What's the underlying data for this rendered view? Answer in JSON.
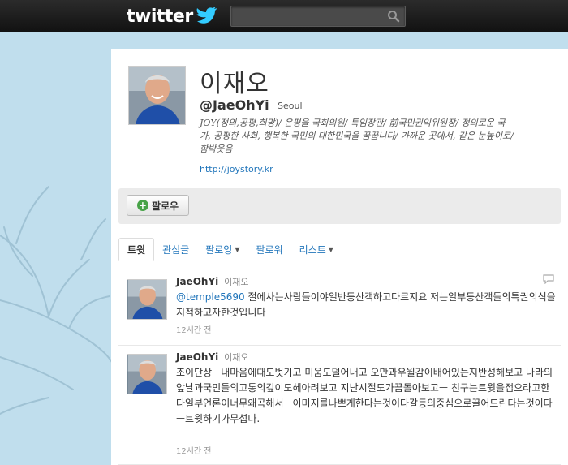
{
  "topbar": {
    "logo_text": "twitter",
    "search_placeholder": ""
  },
  "profile": {
    "name": "이재오",
    "handle": "@JaeOhYi",
    "location": "Seoul",
    "bio": "JOY(정의,공평,희망)/ 은평을 국회의원/ 특임장관/ 前국민권익위원장/ 정의로운 국가, 공평한 사회, 행복한 국민의 대한민국을 꿈꿉니다/ 가까운 곳에서, 같은 눈높이로/ 함박웃음",
    "url": "http://joystory.kr"
  },
  "actions": {
    "follow_label": "팔로우"
  },
  "tabs": [
    {
      "label": "트윗"
    },
    {
      "label": "관심글"
    },
    {
      "label": "팔로잉"
    },
    {
      "label": "팔로워"
    },
    {
      "label": "리스트"
    }
  ],
  "tweets": [
    {
      "user": "JaeOhYi",
      "realname": "이재오",
      "mention": "@temple5690",
      "text": " 절에사는사람들이야일반등산객하고다르지요 저는일부등산객들의특권의식을지적하고자한것입니다",
      "time": "12시간 전"
    },
    {
      "user": "JaeOhYi",
      "realname": "이재오",
      "mention": "",
      "text": "조이단상ㅡ내마음에때도벗기고 미움도덜어내고 오만과우월감이배어있는지반성해보고 나라의앞날과국민들의고통의깊이도헤아려보고 지난시절도가끔돌아보고ㅡ 친구는트윗을접으라고한다일부언론이너무왜곡해서ㅡ이미지를나쁘게한다는것이다갈등의중심으로끌어드린다는것이다ㅡ트윗하기가무섭다.",
      "time": "12시간 전"
    }
  ],
  "colors": {
    "background": "#c0deed",
    "link": "#2276bb",
    "topbar": "#1a1a1a"
  }
}
